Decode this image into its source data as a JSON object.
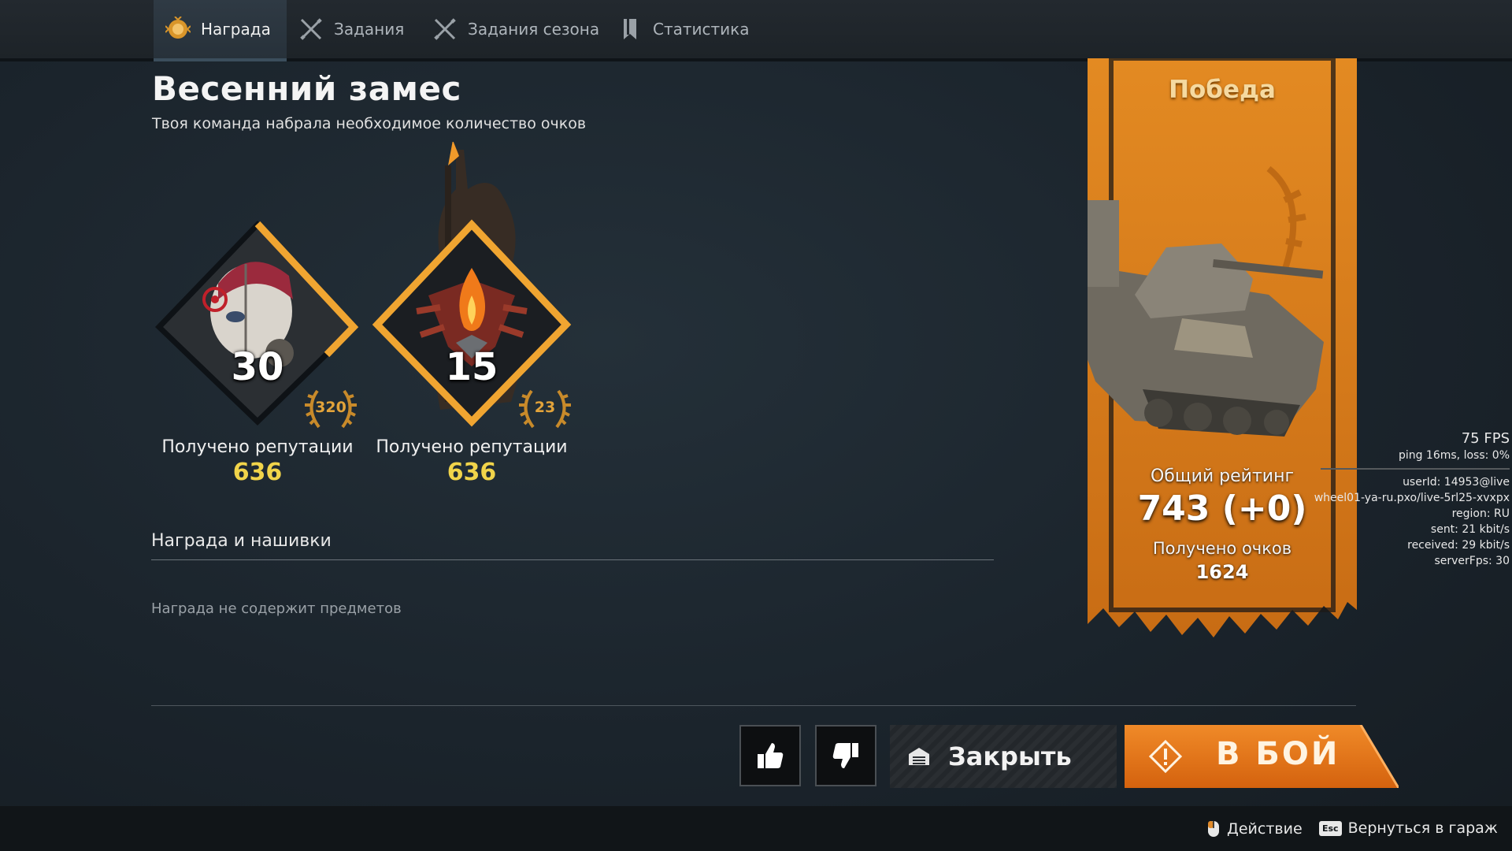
{
  "tabs": [
    {
      "label": "Награда",
      "icon": "reward-badge-icon",
      "active": true
    },
    {
      "label": "Задания",
      "icon": "crossed-swords-icon",
      "active": false
    },
    {
      "label": "Задания сезона",
      "icon": "crossed-swords-icon",
      "active": false
    },
    {
      "label": "Статистика",
      "icon": "bookmark-icon",
      "active": false
    }
  ],
  "header": {
    "title": "Весенний замес",
    "subtitle": "Твоя команда набрала необходимое количество очков"
  },
  "reputation": [
    {
      "level": "30",
      "badge": "320",
      "label": "Получено репутации",
      "value": "636",
      "portrait": "masked-raider-portrait"
    },
    {
      "level": "15",
      "badge": "23",
      "label": "Получено репутации",
      "value": "636",
      "portrait": "fire-faction-emblem"
    }
  ],
  "rewards": {
    "section_title": "Награда и нашивки",
    "empty_text": "Награда не содержит предметов"
  },
  "banner": {
    "result": "Победа",
    "rating_label": "Общий рейтинг",
    "rating_value": "743 (+0)",
    "points_label": "Получено очков",
    "points_value": "1624",
    "accent": "#e0821c"
  },
  "net": {
    "fps": "75 FPS",
    "ping": "ping 16ms, loss:  0%",
    "user": "userId: 14953@live",
    "server": "wheel01-ya-ru.pxo/live-5rl25-xvxpx",
    "region": "region: RU",
    "sent": "sent: 21 kbit/s",
    "received": "received: 29 kbit/s",
    "server_fps": "serverFps: 30"
  },
  "actions": {
    "like_icon": "thumbs-up-icon",
    "dislike_icon": "thumbs-down-icon",
    "close_label": "Закрыть",
    "battle_label": "В БОЙ",
    "battle_color": "#e0761a"
  },
  "footer": {
    "action_hint": "Действие",
    "garage_key": "Esc",
    "garage_hint": "Вернуться в гараж"
  }
}
